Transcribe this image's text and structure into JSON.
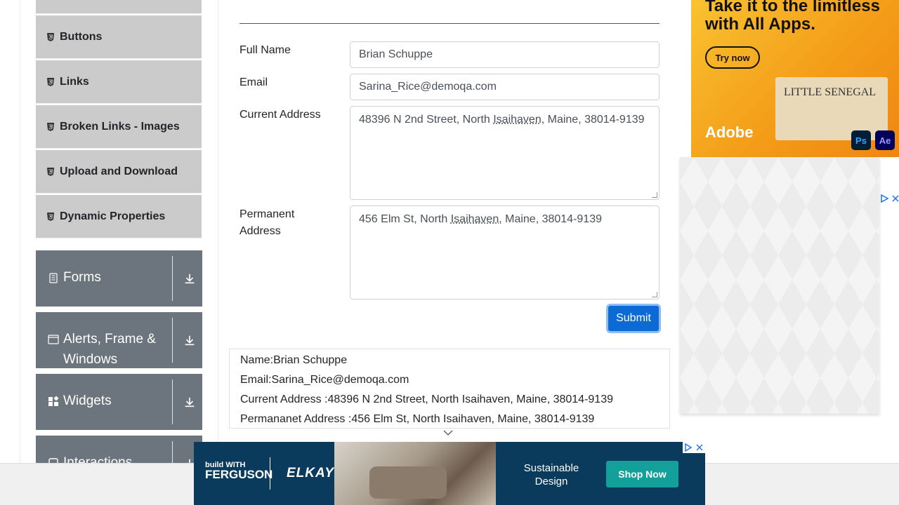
{
  "sidebar": {
    "elements_items": [
      {
        "label": "Buttons"
      },
      {
        "label": "Links"
      },
      {
        "label": "Broken Links - Images"
      },
      {
        "label": "Upload and Download"
      },
      {
        "label": "Dynamic Properties"
      }
    ],
    "groups": [
      {
        "label": "Forms"
      },
      {
        "label": "Alerts, Frame & Windows"
      },
      {
        "label": "Widgets"
      },
      {
        "label": "Interactions"
      }
    ]
  },
  "form": {
    "full_name_label": "Full Name",
    "full_name_value": "Brian Schuppe",
    "email_label": "Email",
    "email_value": "Sarina_Rice@demoqa.com",
    "current_address_label": "Current Address",
    "current_address_value_pre": "48396 N 2nd Street, North ",
    "current_address_value_ul": "Isaihaven",
    "current_address_value_post": ", Maine, 38014-9139",
    "permanent_address_label": "Permanent Address",
    "permanent_address_value_pre": "456 Elm St, North ",
    "permanent_address_value_ul": "Isaihaven",
    "permanent_address_value_post": ", Maine, 38014-9139",
    "submit_label": "Submit"
  },
  "output": {
    "name": "Name:Brian Schuppe",
    "email": "Email:Sarina_Rice@demoqa.com",
    "current_address": "Current Address :48396 N 2nd Street, North Isaihaven, Maine, 38014-9139",
    "permanent_address": "Permananet Address :456 Elm St, North Isaihaven, Maine, 38014-9139"
  },
  "ad_top": {
    "headline": "Take it to the limitless with All Apps.",
    "cta": "Try now",
    "brand": "Adobe",
    "poster_text": "LITTLE SENEGAL",
    "ps": "Ps",
    "ae": "Ae"
  },
  "ad_bottom": {
    "build_small": "build WITH",
    "build_big": "FERGUSON",
    "brand": "ELKAY",
    "tagline": "Sustainable Design",
    "cta": "Shop Now"
  },
  "colors": {
    "submit": "#0b6ad4",
    "group_bg": "#6c757d",
    "item_bg": "#cbcbcb",
    "ad_orange": "#f6a21c",
    "ad_navy": "#0a3a5c",
    "shop_teal": "#14a09a"
  }
}
